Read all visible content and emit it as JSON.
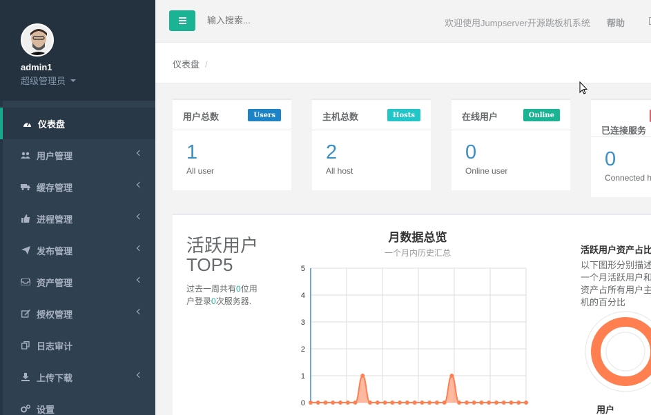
{
  "user": {
    "name": "admin1",
    "role": "超级管理员"
  },
  "nav": {
    "items": [
      {
        "label": "仪表盘",
        "icon": "dashboard-icon",
        "active": true,
        "arrow": false
      },
      {
        "label": "用户管理",
        "icon": "users-icon",
        "active": false,
        "arrow": true
      },
      {
        "label": "缓存管理",
        "icon": "truck-icon",
        "active": false,
        "arrow": true
      },
      {
        "label": "进程管理",
        "icon": "thumbs-up-icon",
        "active": false,
        "arrow": true
      },
      {
        "label": "发布管理",
        "icon": "send-icon",
        "active": false,
        "arrow": true
      },
      {
        "label": "资产管理",
        "icon": "inbox-icon",
        "active": false,
        "arrow": true
      },
      {
        "label": "授权管理",
        "icon": "edit-icon",
        "active": false,
        "arrow": true
      },
      {
        "label": "日志审计",
        "icon": "copy-icon",
        "active": false,
        "arrow": false
      },
      {
        "label": "上传下载",
        "icon": "download-icon",
        "active": false,
        "arrow": true
      },
      {
        "label": "设置",
        "icon": "gears-icon",
        "active": false,
        "arrow": false
      }
    ]
  },
  "topbar": {
    "search_placeholder": "输入搜索...",
    "welcome": "欢迎使用Jumpserver开源跳板机系统",
    "help": "帮助"
  },
  "breadcrumb": {
    "current": "仪表盘",
    "sep": "/"
  },
  "cards": [
    {
      "title": "用户总数",
      "badge": "Users",
      "badge_color": "#1c84c6",
      "value": "1",
      "sub": "All user"
    },
    {
      "title": "主机总数",
      "badge": "Hosts",
      "badge_color": "#23c6c8",
      "value": "2",
      "sub": "All host"
    },
    {
      "title": "在线用户",
      "badge": "Online",
      "badge_color": "#1ab394",
      "value": "0",
      "sub": "Online user"
    },
    {
      "title": "已连接服务",
      "badge": "",
      "badge_color": "#ed5565",
      "value": "0",
      "sub": "Connected h"
    }
  ],
  "top5": {
    "title": "活跃用户TOP5",
    "desc_prefix": "过去一周共有",
    "users": "0",
    "desc_mid": "位用户登录",
    "servers": "0",
    "desc_suffix": "次服务器."
  },
  "chart_data": {
    "type": "area",
    "title": "月数据总览",
    "subtitle": "一个月内历史汇总",
    "ylim": [
      0,
      5
    ],
    "yticks": [
      0,
      1,
      2,
      3,
      4,
      5
    ],
    "points": 30,
    "values": [
      0,
      0,
      0,
      0,
      0,
      0,
      0,
      1,
      0,
      0,
      0,
      0,
      0,
      0,
      0,
      0,
      0,
      0,
      0,
      0,
      0,
      0,
      0,
      0,
      0,
      0,
      0,
      0,
      0,
      0
    ],
    "values2": [
      0,
      0,
      0,
      0,
      0,
      0,
      0,
      0,
      0,
      0,
      0,
      0,
      0,
      0,
      0,
      0,
      0,
      0,
      0,
      0,
      0,
      0,
      0,
      0,
      0,
      0,
      0,
      0,
      0,
      0
    ],
    "peak2_index": 19,
    "grid": true,
    "color": "#ff7f50"
  },
  "right": {
    "title": "活跃用户资产占比",
    "desc": "以下图形分别描述一个月活跃用户和资产占所有用户主机的百分比",
    "donut_label": "用户",
    "donut_fraction": 1
  }
}
